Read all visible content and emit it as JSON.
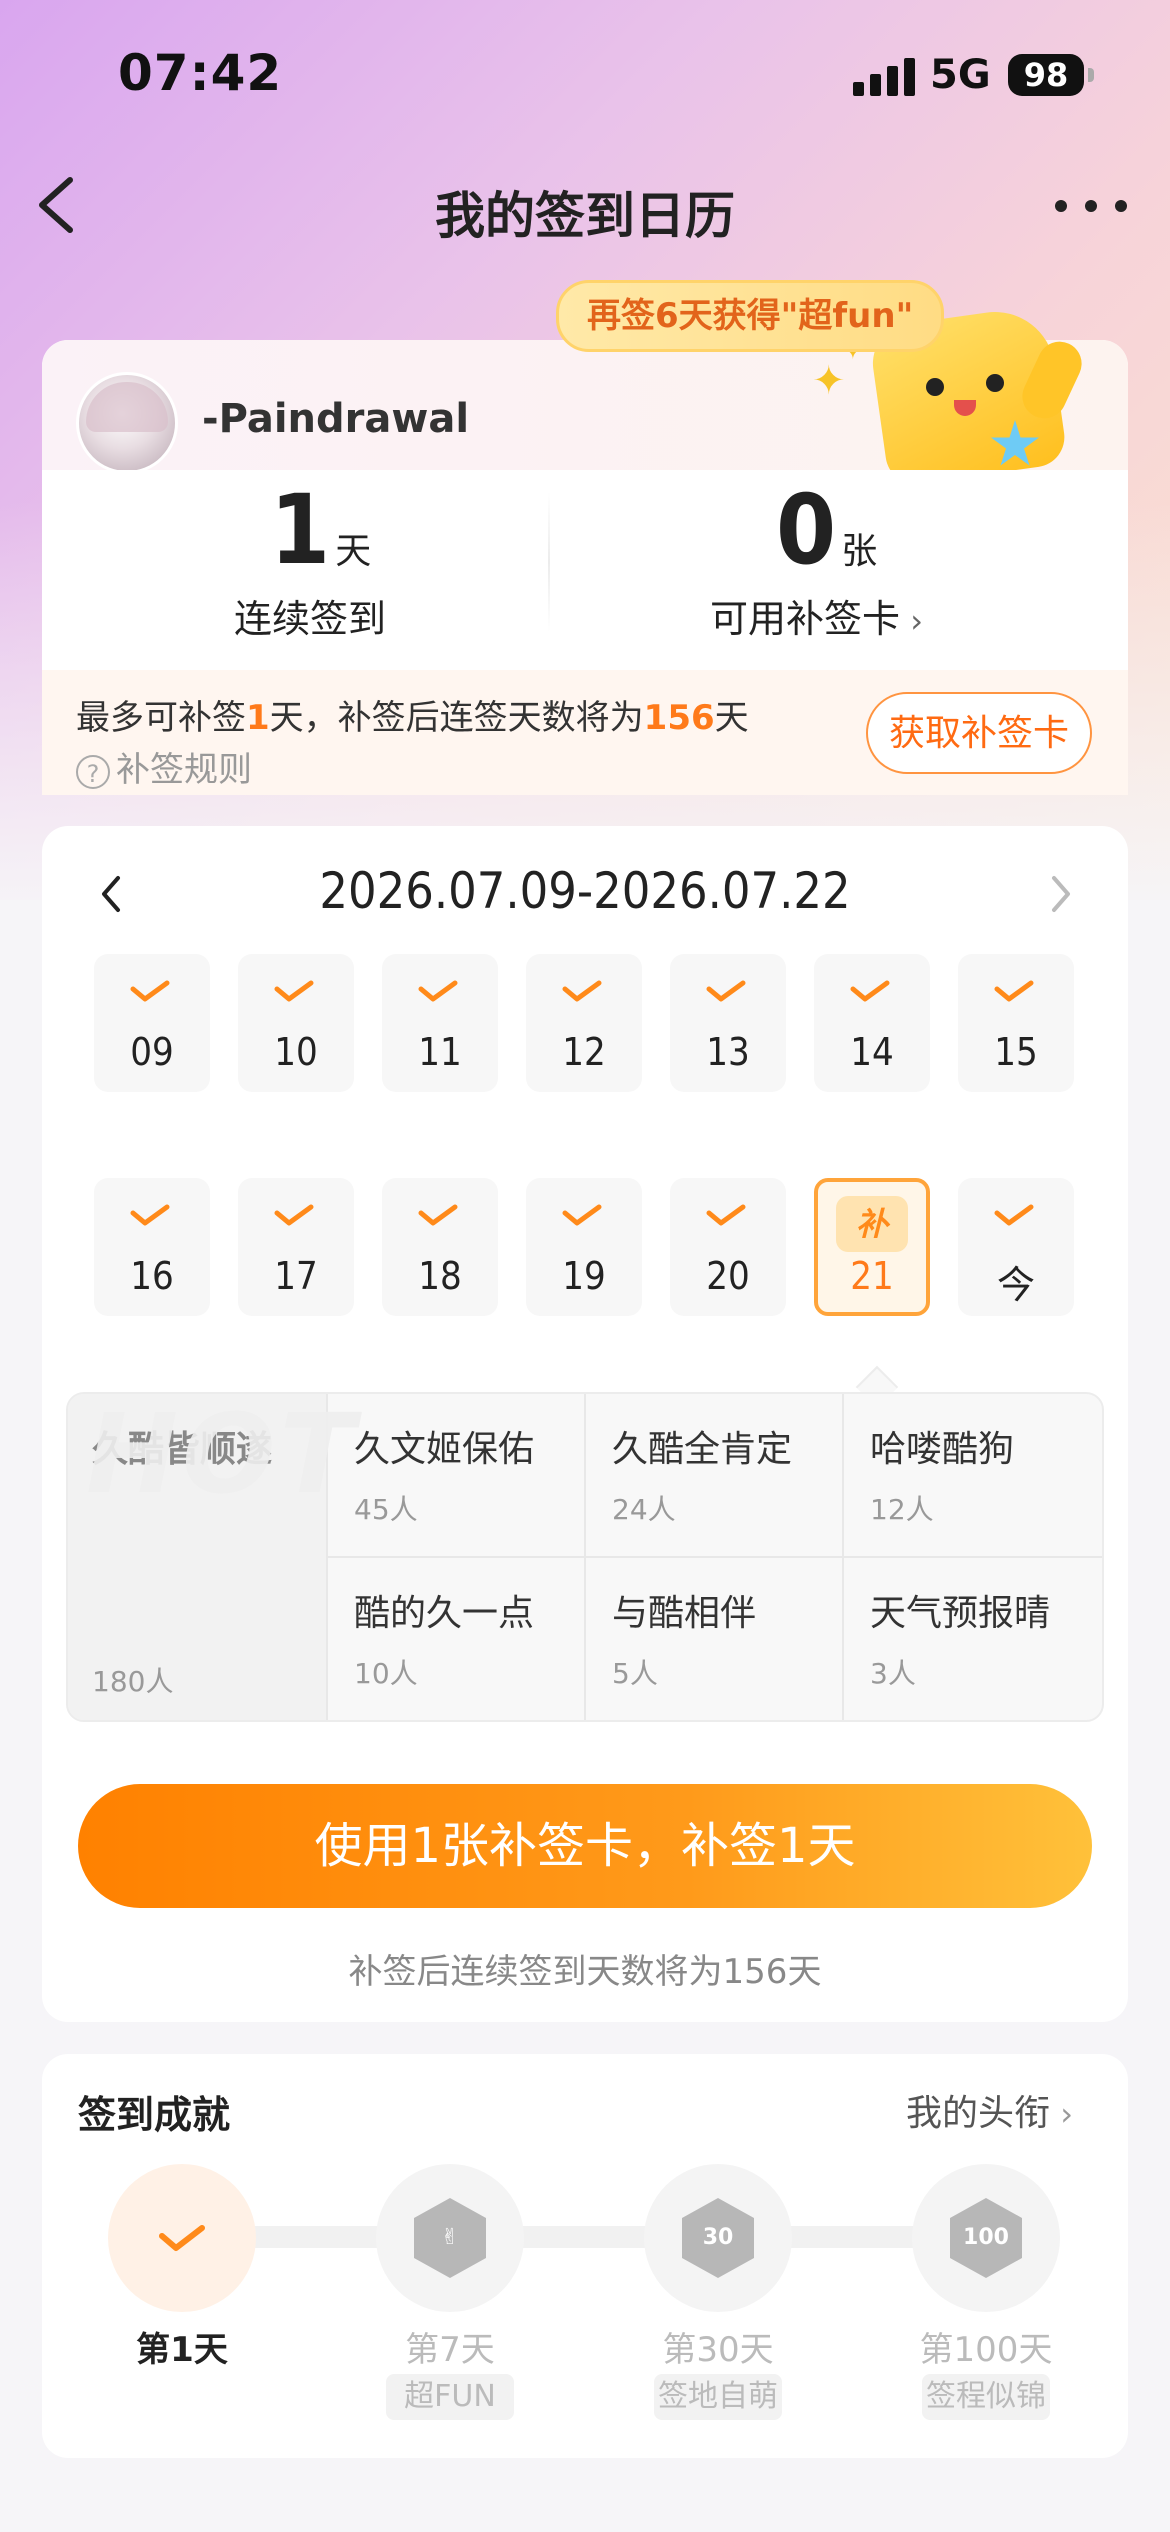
{
  "status_bar": {
    "time": "07:42",
    "network": "5G",
    "battery": "98"
  },
  "nav": {
    "title": "我的签到日历"
  },
  "promo": {
    "text": "再签6天获得\"超fun\""
  },
  "user": {
    "name": "-Paindrawal"
  },
  "stats": {
    "streak_value": "1",
    "streak_unit": "天",
    "streak_label": "连续签到",
    "cards_value": "0",
    "cards_unit": "张",
    "cards_label": "可用补签卡"
  },
  "makeup": {
    "pre": "最多可补签",
    "max_days": "1",
    "mid": "天，补签后连签天数将为",
    "result_days": "156",
    "post": "天",
    "rule_label": "补签规则",
    "get_card_label": "获取补签卡"
  },
  "calendar": {
    "range": "2026.07.09-2026.07.22",
    "days": [
      {
        "label": "09",
        "state": "checked"
      },
      {
        "label": "10",
        "state": "checked"
      },
      {
        "label": "11",
        "state": "checked"
      },
      {
        "label": "12",
        "state": "checked"
      },
      {
        "label": "13",
        "state": "checked"
      },
      {
        "label": "14",
        "state": "checked"
      },
      {
        "label": "15",
        "state": "checked"
      },
      {
        "label": "16",
        "state": "checked"
      },
      {
        "label": "17",
        "state": "checked"
      },
      {
        "label": "18",
        "state": "checked"
      },
      {
        "label": "19",
        "state": "checked"
      },
      {
        "label": "20",
        "state": "checked"
      },
      {
        "label": "21",
        "state": "makeup-selected",
        "tag": "补"
      },
      {
        "label": "今",
        "state": "checked"
      }
    ]
  },
  "titles": {
    "hot_watermark": "HOT",
    "featured": {
      "name": "久酷皆顺遂",
      "count": "180人"
    },
    "items": [
      {
        "name": "久文姬保佑",
        "count": "45人"
      },
      {
        "name": "久酷全肯定",
        "count": "24人"
      },
      {
        "name": "哈喽酷狗",
        "count": "12人"
      },
      {
        "name": "酷的久一点",
        "count": "10人"
      },
      {
        "name": "与酷相伴",
        "count": "5人"
      },
      {
        "name": "天气预报晴",
        "count": "3人"
      }
    ]
  },
  "makeup_action": {
    "button_label": "使用1张补签卡，补签1天",
    "note": "补签后连续签到天数将为156天"
  },
  "achievements": {
    "title": "签到成就",
    "my_titles_label": "我的头衔",
    "items": [
      {
        "day": "第1天",
        "tag": "",
        "unlocked": true
      },
      {
        "day": "第7天",
        "tag": "超FUN",
        "unlocked": false,
        "badge_text": "✌"
      },
      {
        "day": "第30天",
        "tag": "签地自萌",
        "unlocked": false,
        "badge_text": "30"
      },
      {
        "day": "第100天",
        "tag": "签程似锦",
        "unlocked": false,
        "badge_text": "100"
      }
    ]
  },
  "colors": {
    "accent": "#ff7a1a",
    "check": "#ff8a1a",
    "button_start": "#ff8100",
    "button_end": "#ffc13a"
  }
}
